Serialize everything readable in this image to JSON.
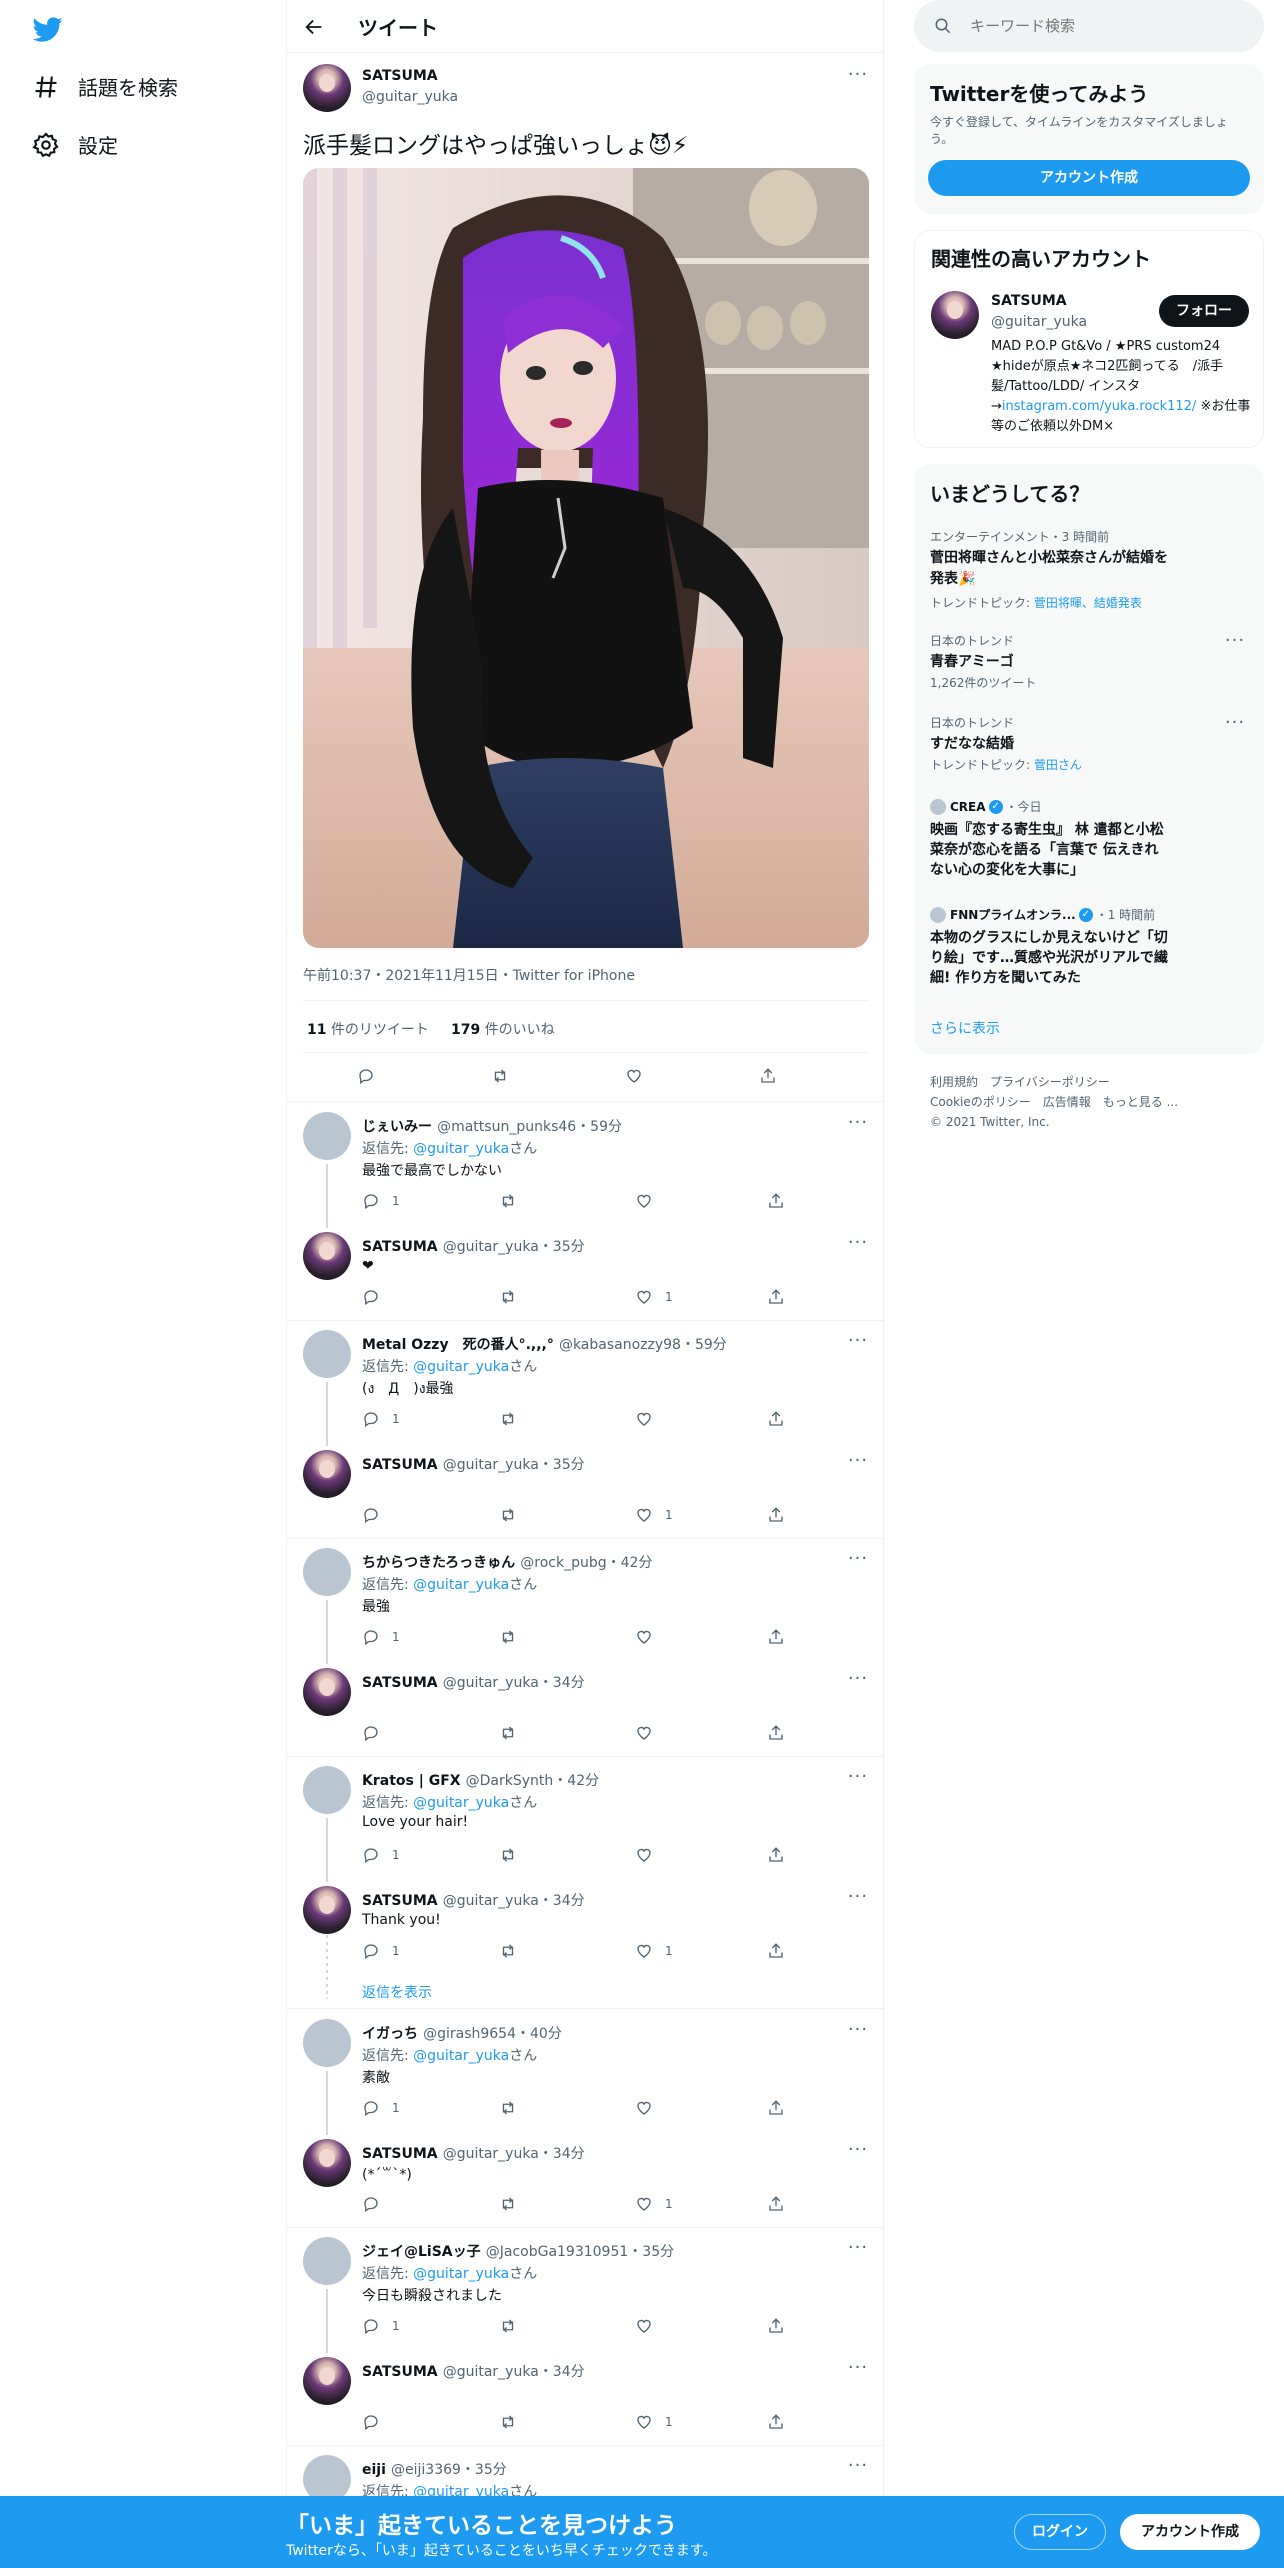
{
  "nav": {
    "explore_label": "話題を検索",
    "settings_label": "設定"
  },
  "header": {
    "title": "ツイート"
  },
  "main_tweet": {
    "name": "SATSUMA",
    "handle": "@guitar_yuka",
    "text": "派手髪ロングはやっぱ強いっしょ😈⚡",
    "meta": "午前10:37・2021年11月15日・Twitter for iPhone",
    "retweet_count": "11",
    "retweet_label": "件のリツイート",
    "like_count": "179",
    "like_label": "件のいいね"
  },
  "reply_prefix": "返信先: ",
  "reply_suffix": "さん",
  "reply_to": "@guitar_yuka",
  "show_replies": "返信を表示",
  "replies": [
    {
      "name": "じぇいみー",
      "handle": "@mattsun_punks46",
      "time": "・59分",
      "reply": true,
      "text": "最強で最高でしかない",
      "reply_count": "1",
      "like_count": ""
    },
    {
      "name": "SATSUMA",
      "handle": "@guitar_yuka",
      "time": "・35分",
      "reply": false,
      "text": "❤",
      "reply_count": "",
      "like_count": "1"
    },
    {
      "name": "Metal Ozzy　死の番人°.,,,°",
      "handle": "@kabasanozzy98",
      "time": "・59分",
      "reply": true,
      "text": "(ง　Д　)ง最強",
      "reply_count": "1",
      "like_count": ""
    },
    {
      "name": "SATSUMA",
      "handle": "@guitar_yuka",
      "time": "・35分",
      "reply": false,
      "text": "",
      "reply_count": "",
      "like_count": "1"
    },
    {
      "name": "ちからつきたろっきゅん",
      "handle": "@rock_pubg",
      "time": "・42分",
      "reply": true,
      "text": "最強",
      "reply_count": "1",
      "like_count": ""
    },
    {
      "name": "SATSUMA",
      "handle": "@guitar_yuka",
      "time": "・34分",
      "reply": false,
      "text": "",
      "reply_count": "",
      "like_count": ""
    },
    {
      "name": "Kratos | GFX",
      "handle": "@DarkSynth",
      "time": "・42分",
      "reply": true,
      "text": "Love your hair!",
      "reply_count": "1",
      "like_count": ""
    },
    {
      "name": "SATSUMA",
      "handle": "@guitar_yuka",
      "time": "・34分",
      "reply": false,
      "text": "Thank you!",
      "reply_count": "1",
      "like_count": "1"
    },
    {
      "name": "イガっち",
      "handle": "@girash9654",
      "time": "・40分",
      "reply": true,
      "text": "素敵",
      "reply_count": "1",
      "like_count": ""
    },
    {
      "name": "SATSUMA",
      "handle": "@guitar_yuka",
      "time": "・34分",
      "reply": false,
      "text": "(*´꒳`*)",
      "reply_count": "",
      "like_count": "1"
    },
    {
      "name": "ジェイ@LiSAッ子",
      "handle": "@JacobGa19310951",
      "time": "・35分",
      "reply": true,
      "text": "今日も瞬殺されました",
      "reply_count": "1",
      "like_count": ""
    },
    {
      "name": "SATSUMA",
      "handle": "@guitar_yuka",
      "time": "・34分",
      "reply": false,
      "text": "",
      "reply_count": "",
      "like_count": "1"
    },
    {
      "name": "eiji",
      "handle": "@eiji3369",
      "time": "・35分",
      "reply": true,
      "text": "",
      "reply_count": "",
      "like_count": ""
    }
  ],
  "search": {
    "placeholder": "キーワード検索"
  },
  "signup_card": {
    "title": "Twitterを使ってみよう",
    "desc": "今すぐ登録して、タイムラインをカスタマイズしましょう。",
    "button": "アカウント作成"
  },
  "relevant": {
    "title": "関連性の高いアカウント",
    "name": "SATSUMA",
    "handle": "@guitar_yuka",
    "follow": "フォロー",
    "bio1": "MAD P.O.P Gt&Vo / ★PRS custom24 ★hideが原点★ネコ2匹飼ってる　/派手髪/Tattoo/LDD/ インスタ→",
    "bio_link": "instagram.com/yuka.rock112/",
    "bio2": " ※お仕事等のご依頼以外DM×"
  },
  "trends": {
    "title": "いまどうしてる？",
    "items": [
      {
        "context": "エンターテインメント・3 時間前",
        "title": "菅田将暉さんと小松菜奈さんが結婚を発表🎉",
        "sub_prefix": "トレンドトピック: ",
        "sub_link": "菅田将暉、結婚発表"
      },
      {
        "context": "日本のトレンド",
        "title": "青春アミーゴ",
        "sub_prefix": "1,262件のツイート",
        "sub_link": ""
      },
      {
        "context": "日本のトレンド",
        "title": "すだなな結婚",
        "sub_prefix": "トレンドトピック: ",
        "sub_link": "菅田さん"
      }
    ],
    "news": [
      {
        "source": "CREA",
        "time": "・今日",
        "title": "映画『恋する寄生虫』 林 遣都と小松菜奈が恋心を語る「言葉で 伝えきれない心の変化を大事に」"
      },
      {
        "source": "FNNプライムオンラ...",
        "time": "・1 時間前",
        "title": "本物のグラスにしか見えないけど「切り絵」です…質感や光沢がリアルで繊細! 作り方を聞いてみた"
      }
    ],
    "show_more": "さらに表示"
  },
  "footer": {
    "l1": "利用規約",
    "l2": "プライバシーポリシー",
    "l3": "Cookieのポリシー",
    "l4": "広告情報",
    "l5": "もっと見る ...",
    "copy": "© 2021 Twitter, Inc."
  },
  "bottom": {
    "headline": "「いま」起きていることを見つけよう",
    "sub": "Twitterなら、「いま」起きていることをいち早くチェックできます。",
    "login": "ログイン",
    "signup": "アカウント作成"
  },
  "colors": {
    "accent": "#1d9bf0",
    "text": "#0f1419",
    "muted": "#536471"
  }
}
